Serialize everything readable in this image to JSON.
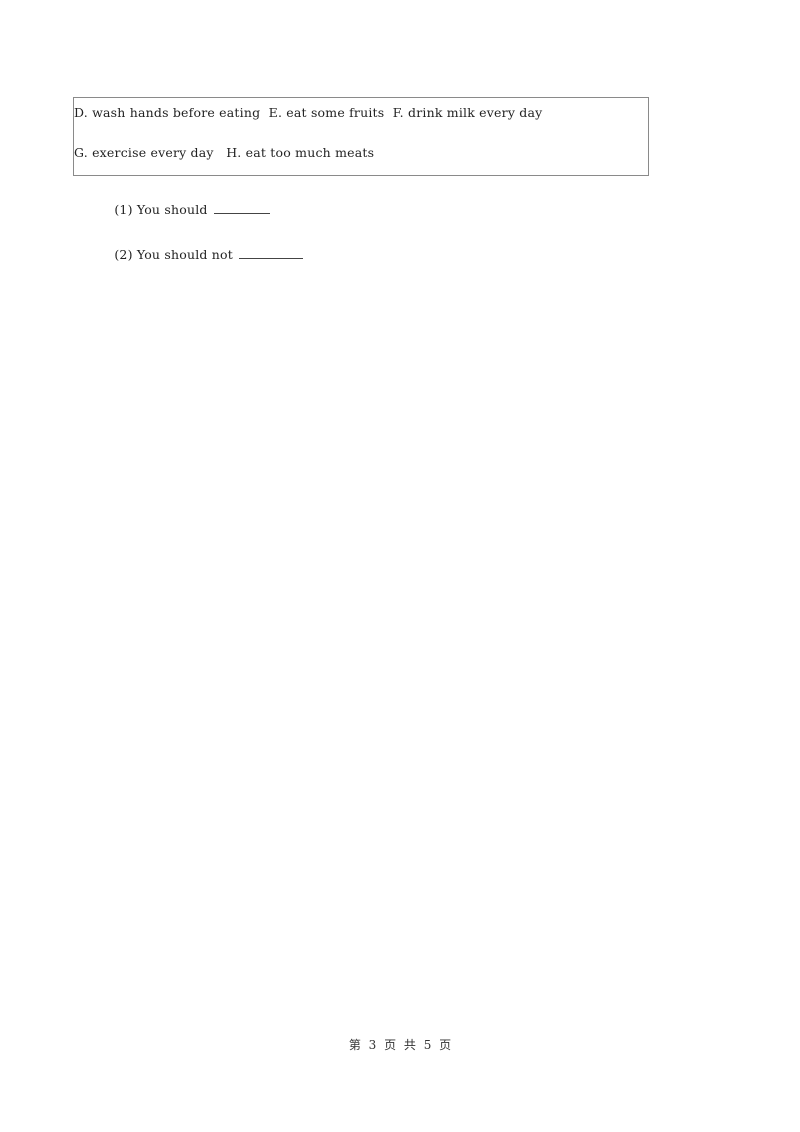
{
  "options_box": {
    "line1": "D. wash hands before eating  E. eat some fruits  F. drink milk every day",
    "line2": "G. exercise every day   H. eat too much meats"
  },
  "questions": [
    {
      "label": "(1) You should"
    },
    {
      "label": "(2) You should not"
    }
  ],
  "footer": {
    "page_text": "第 3 页 共 5 页"
  }
}
